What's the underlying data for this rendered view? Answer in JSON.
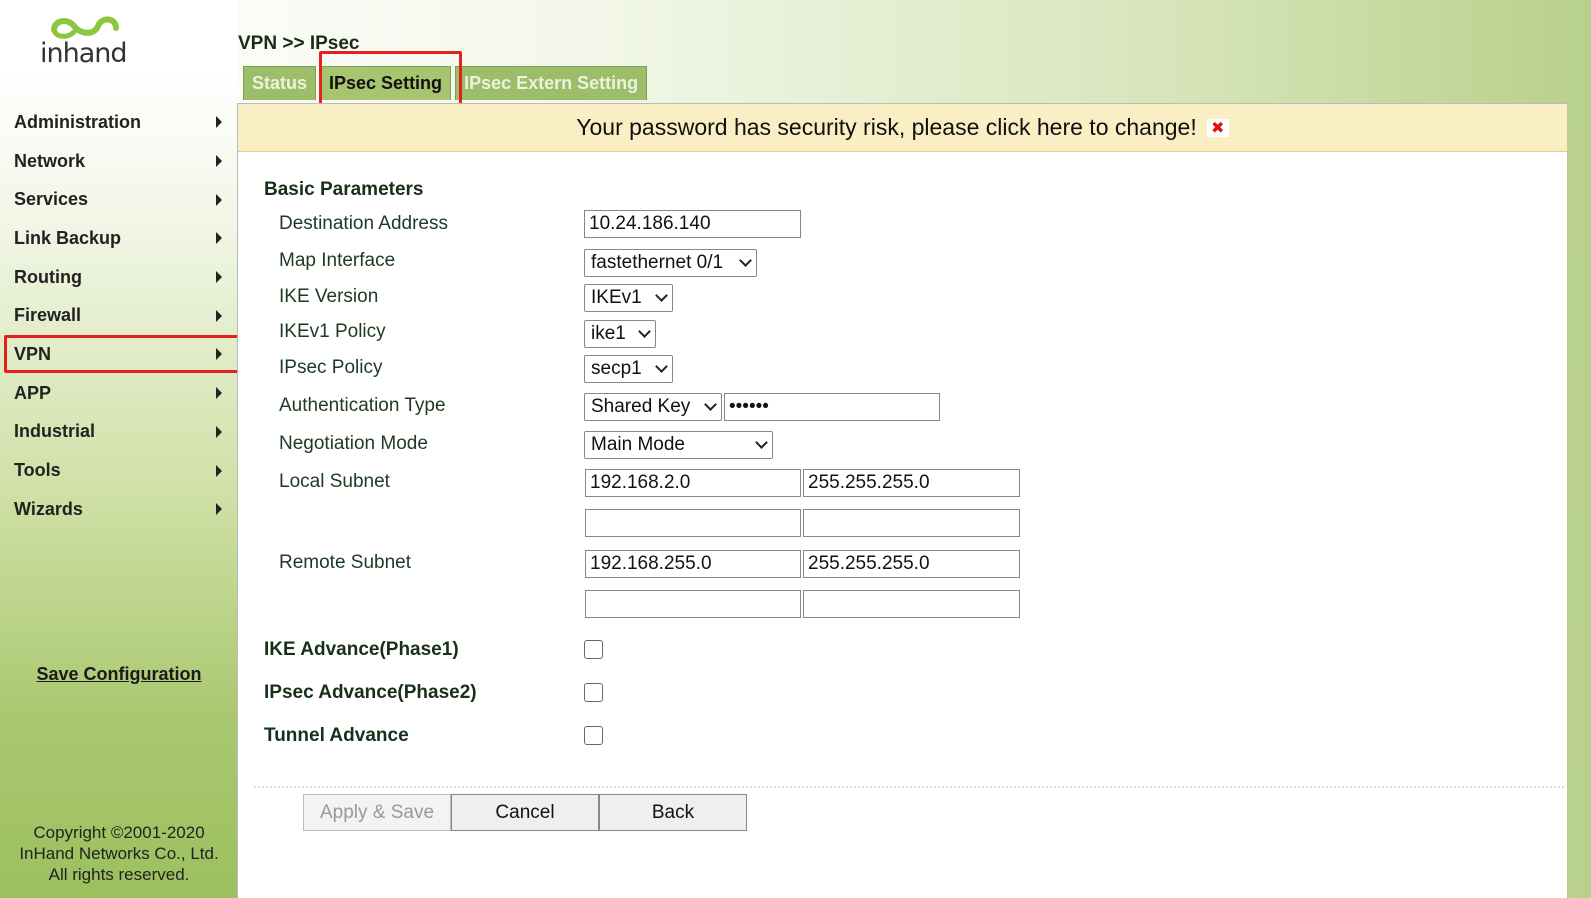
{
  "logo": {
    "text": "inhand"
  },
  "sidebar": {
    "items": [
      {
        "label": "Administration"
      },
      {
        "label": "Network"
      },
      {
        "label": "Services"
      },
      {
        "label": "Link Backup"
      },
      {
        "label": "Routing"
      },
      {
        "label": "Firewall"
      },
      {
        "label": "VPN"
      },
      {
        "label": "APP"
      },
      {
        "label": "Industrial"
      },
      {
        "label": "Tools"
      },
      {
        "label": "Wizards"
      }
    ],
    "save_label": "Save Configuration",
    "copyright": [
      "Copyright ©2001-2020",
      "InHand Networks Co., Ltd.",
      "All rights reserved."
    ]
  },
  "header": {
    "breadcrumb": "VPN >> IPsec",
    "tabs": [
      {
        "label": "Status"
      },
      {
        "label": "IPsec Setting"
      },
      {
        "label": "IPsec Extern Setting"
      }
    ]
  },
  "warning": {
    "text": "Your password has security risk, please click here to change!",
    "close": "✖"
  },
  "form": {
    "section_basic": "Basic Parameters",
    "destination_label": "Destination Address",
    "destination_value": "10.24.186.140",
    "map_interface_label": "Map Interface",
    "map_interface_value": "fastethernet 0/1",
    "ike_version_label": "IKE Version",
    "ike_version_value": "IKEv1",
    "ikev1_policy_label": "IKEv1 Policy",
    "ikev1_policy_value": "ike1",
    "ipsec_policy_label": "IPsec Policy",
    "ipsec_policy_value": "secp1",
    "auth_type_label": "Authentication Type",
    "auth_type_value": "Shared Key",
    "auth_key_value": "••••••",
    "negotiation_label": "Negotiation Mode",
    "negotiation_value": "Main Mode",
    "local_subnet_label": "Local Subnet",
    "local_subnet_ip": "192.168.2.0",
    "local_subnet_mask": "255.255.255.0",
    "local_subnet_ip2": "",
    "local_subnet_mask2": "",
    "remote_subnet_label": "Remote Subnet",
    "remote_subnet_ip": "192.168.255.0",
    "remote_subnet_mask": "255.255.255.0",
    "remote_subnet_ip2": "",
    "remote_subnet_mask2": "",
    "ike_advance_label": "IKE Advance(Phase1)",
    "ipsec_advance_label": "IPsec Advance(Phase2)",
    "tunnel_advance_label": "Tunnel Advance"
  },
  "buttons": {
    "apply": "Apply & Save",
    "cancel": "Cancel",
    "back": "Back"
  },
  "colors": {
    "highlight": "#e62020",
    "tab_active": "#a7c56e",
    "warning_bg": "#faeec4"
  }
}
